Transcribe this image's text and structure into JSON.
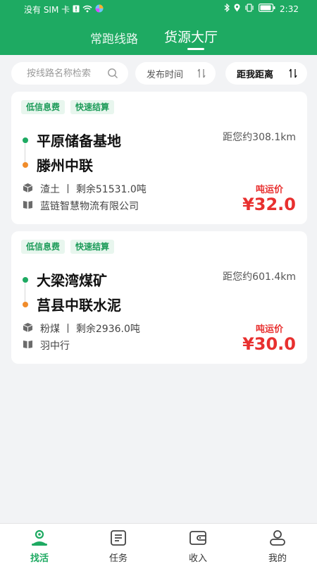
{
  "status_bar": {
    "carrier": "没有 SIM 卡",
    "time": "2:32"
  },
  "top_tabs": [
    {
      "label": "常跑线路",
      "active": false
    },
    {
      "label": "货源大厅",
      "active": true
    }
  ],
  "filters": {
    "search_placeholder": "按线路名称检索",
    "publish_time": "发布时间",
    "distance": "距我距离"
  },
  "cards": [
    {
      "tags": [
        "低信息费",
        "快速结算"
      ],
      "origin": "平原储备基地",
      "destination": "滕州中联",
      "distance": "距您约308.1km",
      "cargo": "渣土 丨 剩余51531.0吨",
      "company": "蓝链智慧物流有限公司",
      "price_label": "吨运价",
      "price": "¥32.0"
    },
    {
      "tags": [
        "低信息费",
        "快速结算"
      ],
      "origin": "大梁湾煤矿",
      "destination": "莒县中联水泥",
      "distance": "距您约601.4km",
      "cargo": "粉煤 丨  剩余2936.0吨",
      "company": "羽中行",
      "price_label": "吨运价",
      "price": "¥30.0"
    }
  ],
  "bottom_nav": [
    {
      "label": "找活",
      "icon": "find-work-icon",
      "active": true
    },
    {
      "label": "任务",
      "icon": "task-icon",
      "active": false
    },
    {
      "label": "收入",
      "icon": "wallet-icon",
      "active": false
    },
    {
      "label": "我的",
      "icon": "profile-icon",
      "active": false
    }
  ],
  "colors": {
    "brand": "#1eaa62",
    "price": "#e8302f",
    "origin_dot": "#1eaa62",
    "destination_dot": "#f08c2b"
  }
}
